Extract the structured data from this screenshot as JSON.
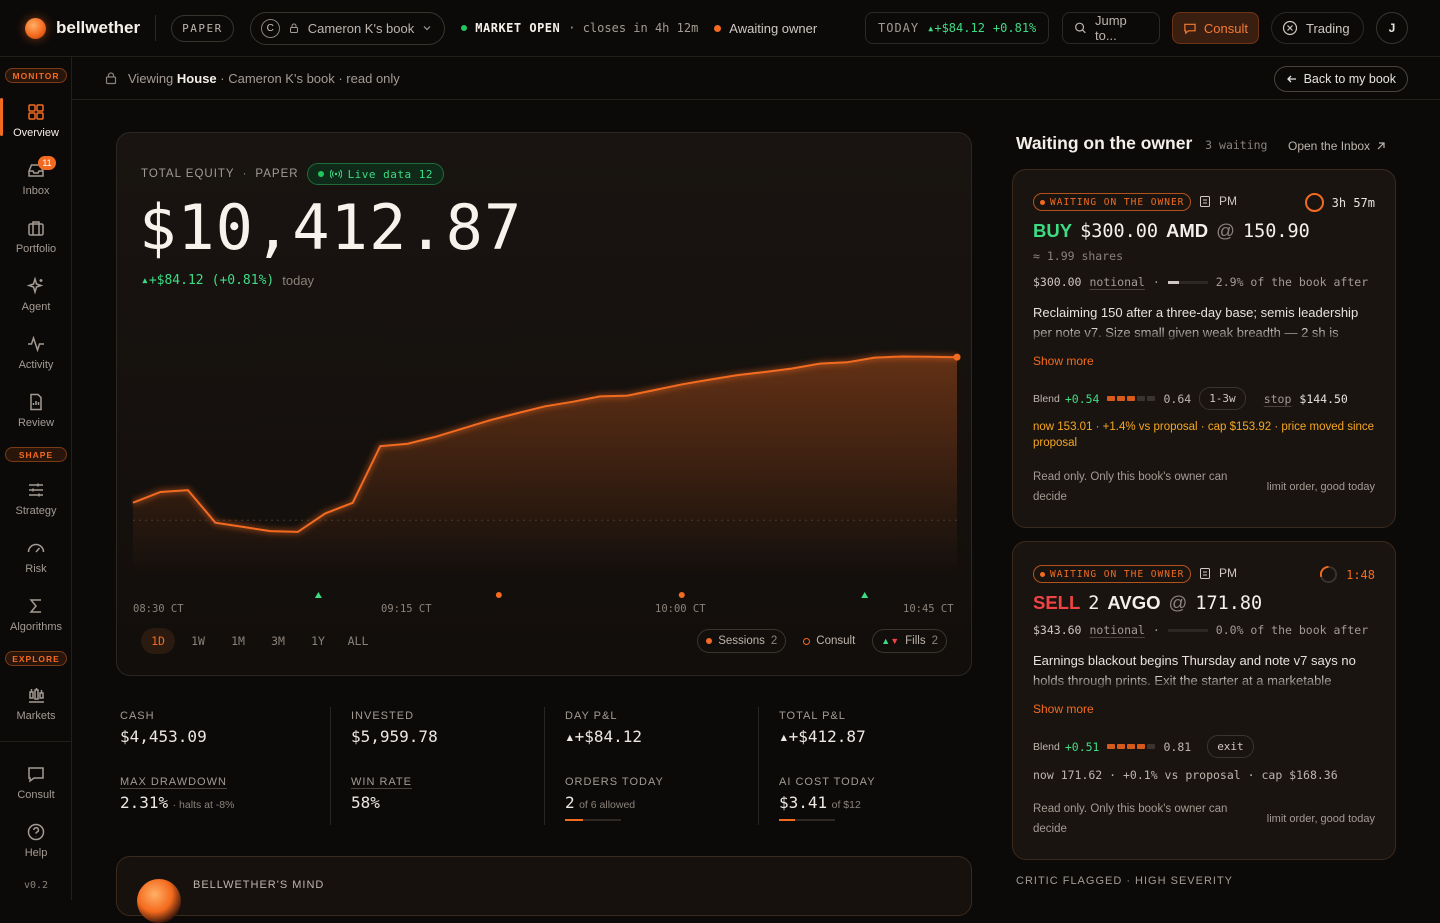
{
  "topbar": {
    "brand": "bellwether",
    "mode_badge": "PAPER",
    "book_initial": "C",
    "book_name": "Cameron K's book",
    "market_status": "MARKET OPEN",
    "market_close": "· closes in 4h 12m",
    "owner_status": "Awaiting owner",
    "today_label": "TODAY",
    "today_value": "▴+$84.12",
    "today_pct": "+0.81%",
    "search_placeholder": "Jump to...",
    "consult_label": "Consult",
    "trading_label": "Trading",
    "avatar_initial": "J"
  },
  "sidebar": {
    "sections": {
      "monitor": "MONITOR",
      "shape": "SHAPE",
      "explore": "EXPLORE"
    },
    "items": [
      {
        "label": "Overview",
        "icon": "grid-icon"
      },
      {
        "label": "Inbox",
        "icon": "inbox-icon",
        "badge": "11"
      },
      {
        "label": "Portfolio",
        "icon": "briefcase-icon"
      },
      {
        "label": "Agent",
        "icon": "sparkle-icon"
      },
      {
        "label": "Activity",
        "icon": "pulse-icon"
      },
      {
        "label": "Review",
        "icon": "document-icon"
      },
      {
        "label": "Strategy",
        "icon": "sliders-icon"
      },
      {
        "label": "Risk",
        "icon": "gauge-icon"
      },
      {
        "label": "Algorithms",
        "icon": "sigma-icon"
      },
      {
        "label": "Markets",
        "icon": "candles-icon"
      },
      {
        "label": "Consult",
        "icon": "chat-icon"
      },
      {
        "label": "Help",
        "icon": "help-icon"
      }
    ],
    "version": "v0.2"
  },
  "subbar": {
    "viewing": "Viewing",
    "house": "House",
    "rest": "· Cameron K's book · read only",
    "back_label": "Back to my book"
  },
  "hero": {
    "label": "TOTAL EQUITY",
    "mode": "PAPER",
    "live_label": "Live data 12",
    "equity": "$10,412.87",
    "change": "▴+$84.12",
    "change_pct": "(+0.81%)",
    "change_period": "today",
    "ranges": [
      "1D",
      "1W",
      "1M",
      "3M",
      "1Y",
      "ALL"
    ],
    "legend": {
      "sessions": "Sessions",
      "sessions_count": "2",
      "consult": "Consult",
      "fills": "Fills",
      "fills_count": "2"
    }
  },
  "chart_data": {
    "type": "area",
    "x_labels": [
      "08:30 CT",
      "09:15 CT",
      "10:00 CT",
      "10:45 CT"
    ],
    "series": [
      {
        "values": [
          10339.6,
          10346.2,
          10347.4,
          10327.2,
          10324.6,
          10322.0,
          10321.5,
          10333.0,
          10339.5,
          10374.5,
          10376.1,
          10380.3,
          10385.4,
          10390.6,
          10395.0,
          10399.2,
          10402.0,
          10405.3,
          10405.8,
          10409.3,
          10412.8,
          10415.7,
          10418.5,
          10420.4,
          10422.6,
          10425.6,
          10426.4,
          10429.3,
          10430.0,
          10429.8,
          10429.6
        ]
      }
    ],
    "color": "#f26b21",
    "baseline": 10328.75,
    "markers": [
      {
        "kind": "fill-buy",
        "x": 0.225
      },
      {
        "kind": "consult",
        "x": 0.444
      },
      {
        "kind": "consult",
        "x": 0.666
      },
      {
        "kind": "fill-buy",
        "x": 0.888
      }
    ]
  },
  "stats": [
    {
      "label": "CASH",
      "value": "$4,453.09"
    },
    {
      "label": "INVESTED",
      "value": "$5,959.78"
    },
    {
      "label": "DAY P&L",
      "value": "▴+$84.12",
      "tone": "green"
    },
    {
      "label": "TOTAL P&L",
      "value": "▴+$412.87",
      "tone": "green"
    },
    {
      "label": "MAX DRAWDOWN",
      "value": "2.31%",
      "sub": "· halts at -8%"
    },
    {
      "label": "WIN RATE",
      "value": "58%"
    },
    {
      "label": "ORDERS TODAY",
      "value": "2",
      "sub": "of 6 allowed",
      "progress": 0.33
    },
    {
      "label": "AI COST TODAY",
      "value": "$3.41",
      "sub": "of $12",
      "progress": 0.28
    }
  ],
  "mind": {
    "title": "BELLWETHER'S MIND"
  },
  "waiting": {
    "title": "Waiting on the owner",
    "count": "3 waiting",
    "open_inbox": "Open the Inbox"
  },
  "cards": [
    {
      "tag": "WAITING ON THE OWNER",
      "role": "PM",
      "timer": "3h 57m",
      "side": "BUY",
      "qty": "$300.00",
      "symbol": "AMD",
      "at": "@",
      "price": "150.90",
      "shares": "≈ 1.99 shares",
      "notional": "$300.00",
      "notional_label": "notional",
      "book_after": "2.9% of the book after",
      "book_after_value": 0.29,
      "rationale": "Reclaiming 150 after a three-day base; semis leadership per note v7. Size small given weak breadth — 2 sh is",
      "show_more": "Show more",
      "blend_label": "Blend",
      "blend": "+0.54",
      "conf": "0.64",
      "conf_segs": 3,
      "horizon": "1-3w",
      "stop_label": "stop",
      "stop": "$144.50",
      "now_line": "now 153.01 · +1.4% vs proposal · cap $153.92 · price moved since proposal",
      "readonly": "Read only. Only this book's owner can decide",
      "order_type": "limit order, good today"
    },
    {
      "tag": "WAITING ON THE OWNER",
      "role": "PM",
      "timer": "1:48",
      "side": "SELL",
      "qty": "2",
      "symbol": "AVGO",
      "at": "@",
      "price": "171.80",
      "notional": "$343.60",
      "notional_label": "notional",
      "book_after": "0.0% of the book after",
      "book_after_value": 0,
      "rationale": "Earnings blackout begins Thursday and note v7 says no holds through prints. Exit the starter at a marketable",
      "show_more": "Show more",
      "blend_label": "Blend",
      "blend": "+0.51",
      "conf": "0.81",
      "conf_segs": 4,
      "horizon": "exit",
      "now_line": "now 171.62 · +0.1% vs proposal · cap $168.36",
      "readonly": "Read only. Only this book's owner can decide",
      "order_type": "limit order, good today"
    }
  ],
  "critic": "CRITIC FLAGGED · HIGH SEVERITY"
}
